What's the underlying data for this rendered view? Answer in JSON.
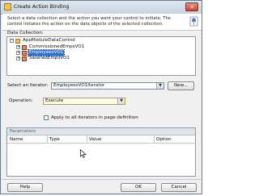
{
  "window": {
    "title": "Create Action Binding",
    "close_glyph": "✕",
    "icon": "app-icon"
  },
  "instructions": {
    "text": "Select a data collection and the action you want your control to initiate. The control initiates the action on the data objects of the selected collection.",
    "icon": "help-info-icon"
  },
  "data_collection": {
    "label": "Data Collection:",
    "tree": [
      {
        "label": "AppModuleDataControl",
        "expander": "−",
        "icon": "folder-icon"
      },
      {
        "label": "CommissionedEmpsVO1",
        "expander": "+",
        "icon": "view-object-icon"
      },
      {
        "label": "EmployeesVO1",
        "expander": "+",
        "icon": "view-object-icon",
        "selected": true
      },
      {
        "label": "SalariedEmpsVO1",
        "expander": "+",
        "icon": "view-object-icon"
      }
    ]
  },
  "iterator": {
    "label": "Select an Iterator:",
    "value": "EmployeesVO1Iterator",
    "new_button": "New..."
  },
  "operation": {
    "label": "Operation:",
    "value": "Execute"
  },
  "apply_all": {
    "label": "Apply to all iterators in page definition",
    "checked": false
  },
  "parameters": {
    "title": "Parameters",
    "columns": [
      "Name",
      "Type",
      "Value",
      "Option"
    ]
  },
  "footer": {
    "help_button": "Help",
    "ok_button": "OK",
    "cancel_button": "Cancel"
  }
}
